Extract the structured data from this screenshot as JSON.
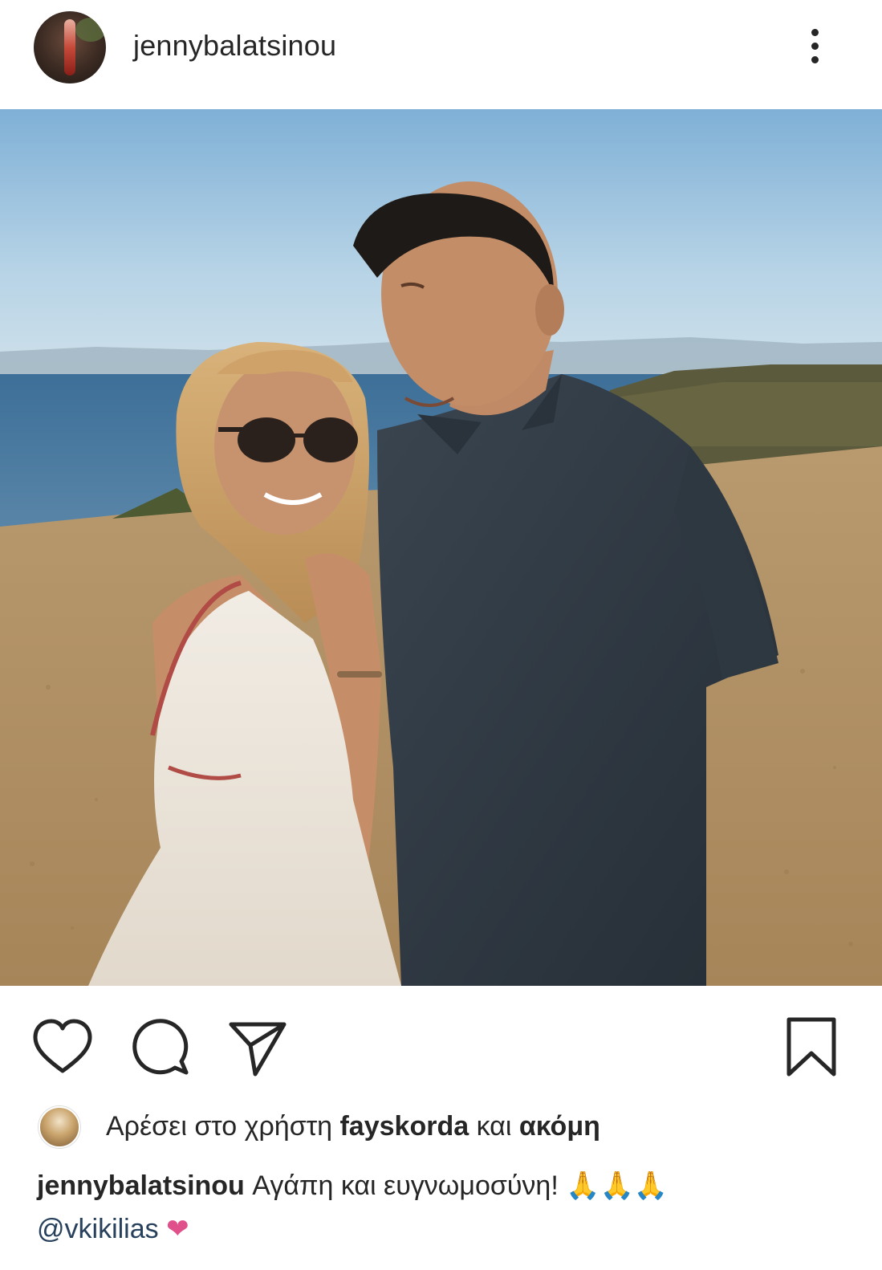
{
  "post": {
    "username": "jennybalatsinou",
    "icons": {
      "more": "more-vertical-icon",
      "like": "heart-outline-icon",
      "comment": "comment-bubble-icon",
      "share": "paper-plane-icon",
      "save": "bookmark-outline-icon"
    },
    "likes": {
      "prefix": "Αρέσει στο χρήστη",
      "user": "fayskorda",
      "middle": "και",
      "suffix": "ακόμη"
    },
    "caption": {
      "author": "jennybalatsinou",
      "text": "Αγάπη και ευγνωμοσύνη!",
      "emoji": "🙏🙏🙏",
      "mention": "@vkikilias",
      "emoji_end": "❤"
    }
  }
}
